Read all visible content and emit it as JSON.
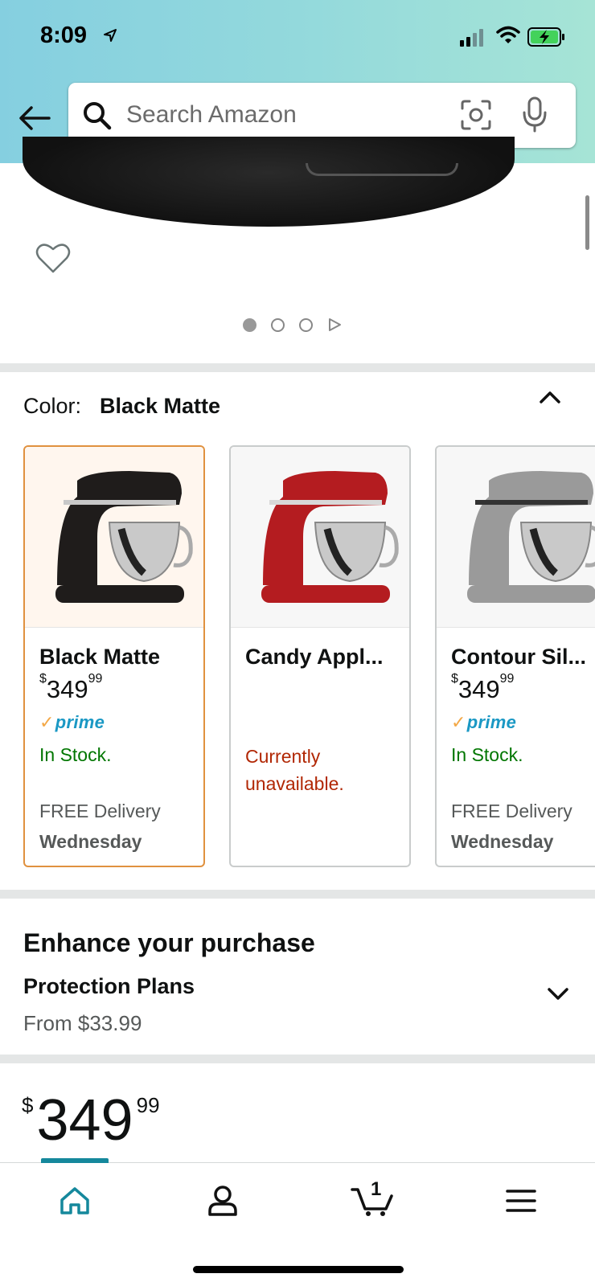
{
  "status_bar": {
    "time": "8:09"
  },
  "search": {
    "placeholder": "Search Amazon"
  },
  "gallery": {
    "image_count": 3,
    "has_video": true,
    "active_index": 0
  },
  "color_section": {
    "label": "Color:",
    "selected": "Black Matte",
    "options": [
      {
        "name": "Black Matte",
        "price_whole": "349",
        "price_cents": "99",
        "prime": "prime",
        "availability": "In Stock.",
        "delivery": "FREE Delivery",
        "delivery_day": "Wednesday",
        "color": "#1f1c1b"
      },
      {
        "name": "Candy Appl...",
        "availability": "Currently unavailable.",
        "color": "#b41c20"
      },
      {
        "name": "Contour Sil...",
        "price_whole": "349",
        "price_cents": "99",
        "prime": "prime",
        "availability": "In Stock.",
        "delivery": "FREE Delivery",
        "delivery_day": "Wednesday",
        "color": "#9a9a9a"
      }
    ]
  },
  "enhance": {
    "title": "Enhance your purchase",
    "plans_title": "Protection Plans",
    "plans_from": "From $33.99"
  },
  "price": {
    "currency": "$",
    "whole": "349",
    "cents": "99"
  },
  "cart": {
    "count": "1"
  },
  "colors": {
    "accent": "#15889c",
    "in_stock": "#007600",
    "unavailable": "#b12704",
    "selected_border": "#e0913f"
  }
}
